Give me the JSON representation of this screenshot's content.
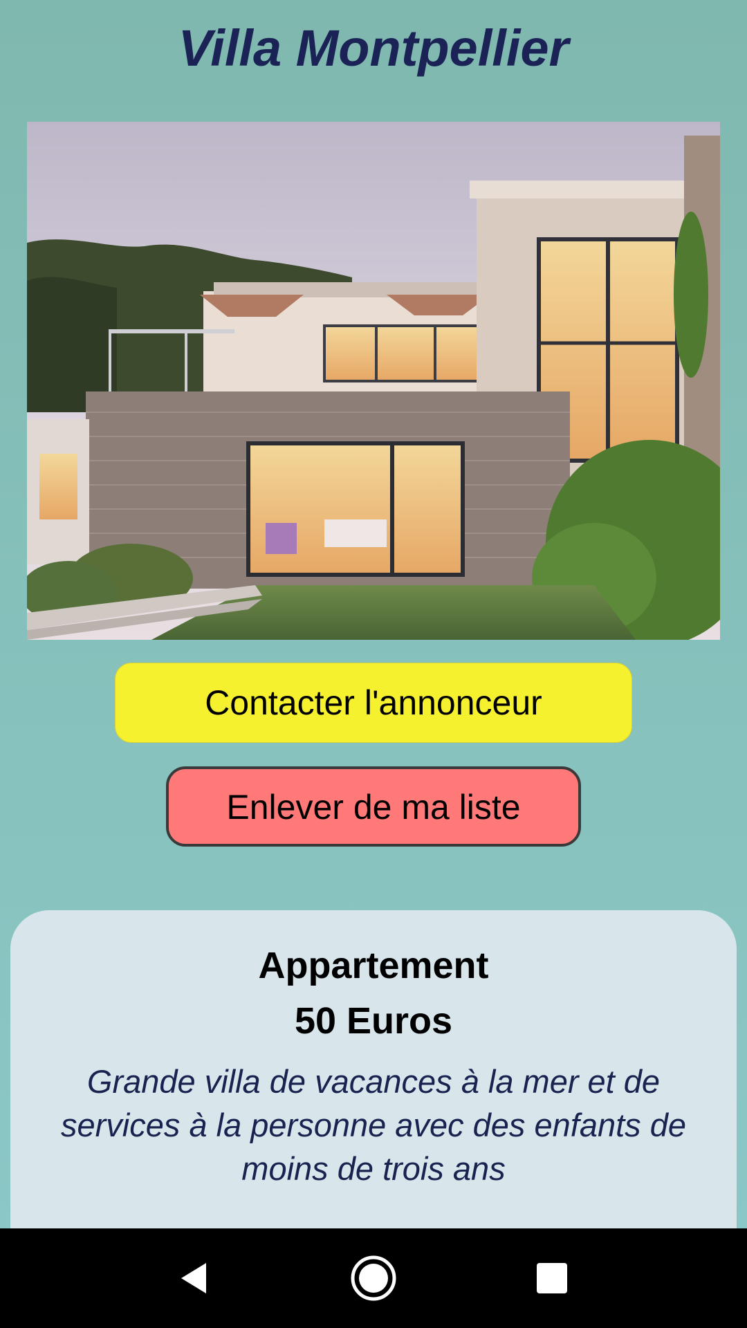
{
  "listing": {
    "title": "Villa Montpellier",
    "photo_alt": "Villa Montpellier",
    "type": "Appartement",
    "price": "50 Euros",
    "description": "Grande villa de vacances à la mer et de services à la personne avec des enfants de moins de trois ans"
  },
  "actions": {
    "contact_label": "Contacter l'annonceur",
    "remove_label": "Enlever de ma liste"
  },
  "colors": {
    "title": "#1b2356",
    "contact_button": "#f5f12e",
    "remove_button": "#ff7979",
    "card_background": "#d8e6ec",
    "background_top": "#7fb8ae",
    "background_bottom": "#8cc8c8"
  },
  "navigation_bar": {
    "back_icon": "back-triangle-icon",
    "home_icon": "home-circle-icon",
    "recent_icon": "recent-apps-square-icon"
  }
}
